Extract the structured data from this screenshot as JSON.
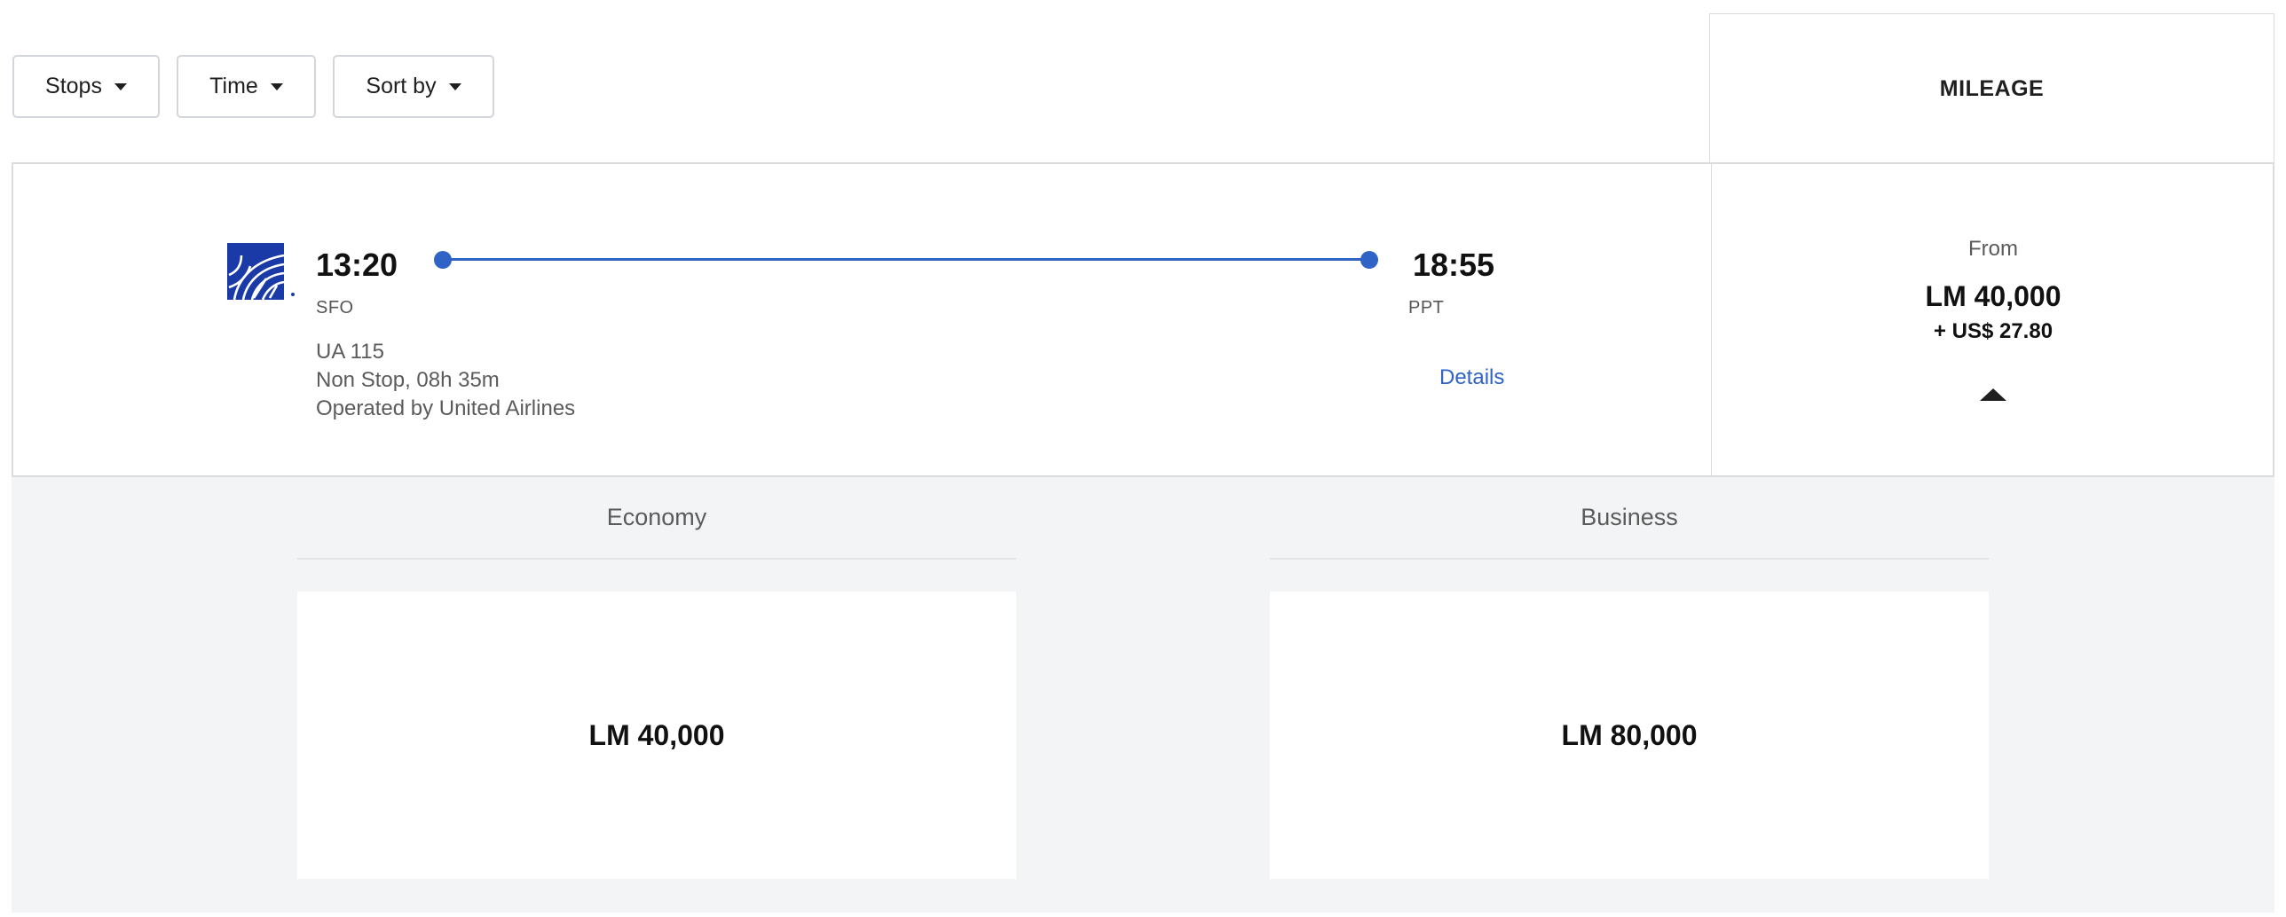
{
  "filters": {
    "stops_label": "Stops",
    "time_label": "Time",
    "sort_label": "Sort by"
  },
  "mileage_header": "MILEAGE",
  "flight": {
    "airline_logo": "united-globe-icon",
    "departure_time": "13:20",
    "departure_code": "SFO",
    "arrival_time": "18:55",
    "arrival_code": "PPT",
    "flight_number": "UA 115",
    "duration": "Non Stop, 08h 35m",
    "operator": "Operated by United Airlines",
    "details_label": "Details"
  },
  "price": {
    "from_label": "From",
    "miles": "LM 40,000",
    "tax": "+ US$ 27.80"
  },
  "fares": {
    "economy": {
      "title": "Economy",
      "price": "LM 40,000"
    },
    "business": {
      "title": "Business",
      "price": "LM 80,000"
    }
  },
  "colors": {
    "accent": "#2f63c5",
    "united_blue": "#1a3aa8",
    "panel_bg": "#f3f4f5"
  }
}
